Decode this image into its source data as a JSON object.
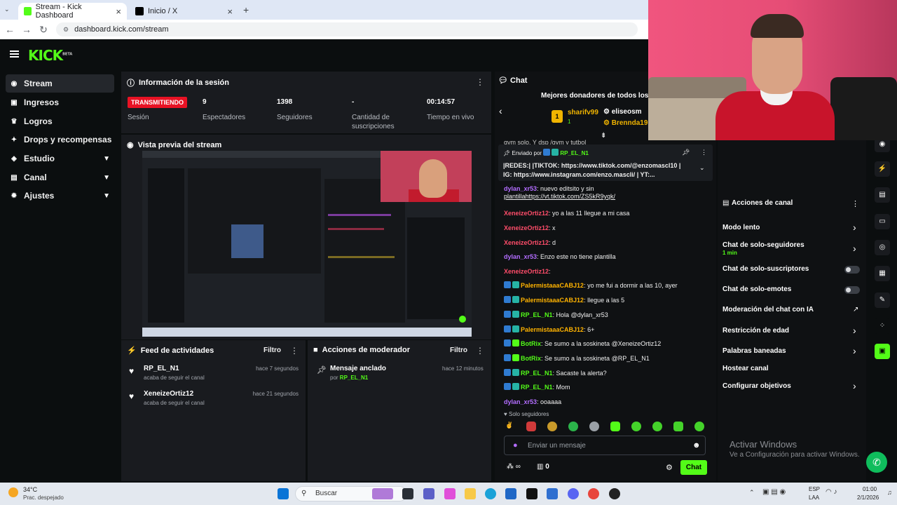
{
  "browser": {
    "tabs": [
      {
        "title": "Stream - Kick Dashboard"
      },
      {
        "title": "Inicio / X"
      }
    ],
    "url": "dashboard.kick.com/stream",
    "new_tab": "+"
  },
  "header": {
    "logo": "KICK",
    "logo_badge": "BETA"
  },
  "sidebar": {
    "items": [
      {
        "label": "Stream",
        "icon": "broadcast-icon",
        "active": true
      },
      {
        "label": "Ingresos",
        "icon": "money-icon"
      },
      {
        "label": "Logros",
        "icon": "trophy-icon"
      },
      {
        "label": "Drops y recompensas",
        "icon": "gift-icon"
      },
      {
        "label": "Estudio",
        "icon": "studio-icon",
        "expandable": true
      },
      {
        "label": "Canal",
        "icon": "channel-icon",
        "expandable": true
      },
      {
        "label": "Ajustes",
        "icon": "gear-icon",
        "expandable": true
      }
    ]
  },
  "session": {
    "title": "Información de la sesión",
    "live_badge": "TRANSMITIENDO",
    "session_label": "Sesión",
    "stats": [
      {
        "value": "9",
        "label": "Espectadores"
      },
      {
        "value": "1398",
        "label": "Seguidores"
      },
      {
        "value": "-",
        "label": "Cantidad de suscripciones"
      },
      {
        "value": "00:14:57",
        "label": "Tiempo en vivo"
      }
    ]
  },
  "preview": {
    "title": "Vista previa del stream"
  },
  "activity": {
    "title": "Feed de actividades",
    "filter": "Filtro",
    "items": [
      {
        "name": "RP_EL_N1",
        "action": "acaba de seguir el canal",
        "time": "hace 7 segundos"
      },
      {
        "name": "XeneizeOrtiz12",
        "action": "acaba de seguir el canal",
        "time": "hace 21 segundos"
      }
    ]
  },
  "moderator": {
    "title": "Acciones de moderador",
    "filter": "Filtro",
    "items": [
      {
        "title": "Mensaje anclado",
        "by_label": "por",
        "by_user": "RP_EL_N1",
        "time": "hace 12 minutos"
      }
    ]
  },
  "chat": {
    "title": "Chat",
    "donors_title": "Mejores donadores de todos los ti",
    "donors": [
      {
        "name": "sharifv99",
        "count": "1"
      },
      {
        "name": "eliseosm"
      },
      {
        "name": "Brennda19"
      }
    ],
    "top_line": "gym solo, Y dsp /gym y tutbol",
    "pinned": {
      "sent_by_label": "Enviado por",
      "sent_by_user": "RP_EL_N1",
      "text_1": "|REDES:| |TIKTOK: https://www.tiktok.com/@enzomascl10 |",
      "text_2": "IG: https://www.instagram.com/enzo.mascli/ | YT:..."
    },
    "messages": [
      {
        "user": "dylan_xr53",
        "text": "nuevo editsito y sin",
        "color": "#b36dff"
      },
      {
        "user": "",
        "text": "plantillahttps://vt.tiktok.com/ZS5kR9yqk/",
        "color": "#b36dff"
      },
      {
        "user": "XeneizeOrtiz12",
        "text": "yo a las 11 llegue a mi casa",
        "color": "#ff4d6a"
      },
      {
        "user": "XeneizeOrtiz12",
        "text": "x",
        "color": "#ff4d6a"
      },
      {
        "user": "XeneizeOrtiz12",
        "text": "d",
        "color": "#ff4d6a"
      },
      {
        "user": "dylan_xr53",
        "text": "Enzo este no tiene plantilla",
        "color": "#b36dff"
      },
      {
        "user": "XeneizeOrtiz12",
        "text": "",
        "color": "#ff4d6a"
      },
      {
        "user": "PalermistaaaCABJ12",
        "text": "yo me fui a dormir a las 10, ayer",
        "color": "#ffb300"
      },
      {
        "user": "PalermistaaaCABJ12",
        "text": "llegue a las 5",
        "color": "#ffb300"
      },
      {
        "user": "RP_EL_N1",
        "text": "Hola @dylan_xr53",
        "color": "#53fc18"
      },
      {
        "user": "PalermistaaaCABJ12",
        "text": "6+",
        "color": "#ffb300"
      },
      {
        "user": "BotRix",
        "text": "Se sumo a la soskineta @XeneizeOrtiz12",
        "color": "#53fc18"
      },
      {
        "user": "BotRix",
        "text": "Se sumo a la soskineta @RP_EL_N1",
        "color": "#53fc18"
      },
      {
        "user": "RP_EL_N1",
        "text": "Sacaste la alerta?",
        "color": "#53fc18"
      },
      {
        "user": "RP_EL_N1",
        "text": "Mom",
        "color": "#53fc18"
      },
      {
        "user": "dylan_xr53",
        "text": "ooaaaa",
        "color": "#b36dff"
      }
    ],
    "followers_only": "Solo seguidores",
    "input_placeholder": "Enviar un mensaje",
    "infinity": "∞",
    "points": "0",
    "send_button": "Chat"
  },
  "channel_actions": {
    "title": "Acciones de canal",
    "items": [
      {
        "label": "Modo lento",
        "control": "chevron"
      },
      {
        "label": "Chat de solo-seguidores",
        "sub": "1 min",
        "control": "chevron"
      },
      {
        "label": "Chat de solo-suscriptores",
        "control": "toggle"
      },
      {
        "label": "Chat de solo-emotes",
        "control": "toggle"
      },
      {
        "label": "Moderación del chat con IA",
        "control": "external"
      },
      {
        "label": "Restricción de edad",
        "control": "chevron"
      },
      {
        "label": "Palabras baneadas",
        "control": "chevron"
      },
      {
        "label": "Hostear canal",
        "control": "none"
      },
      {
        "label": "Configurar objetivos",
        "control": "chevron"
      }
    ]
  },
  "watermark": {
    "line1": "Activar Windows",
    "line2": "Ve a Configuración para activar Windows."
  },
  "taskbar": {
    "weather_temp": "34°C",
    "weather_desc": "Prac. despejado",
    "search": "Buscar",
    "lang_top": "ESP",
    "lang_bottom": "LAA",
    "time": "01:00",
    "date": "2/1/2026"
  },
  "colors": {
    "accent": "#53fc18",
    "live": "#e81224",
    "panel": "#191b1f"
  }
}
